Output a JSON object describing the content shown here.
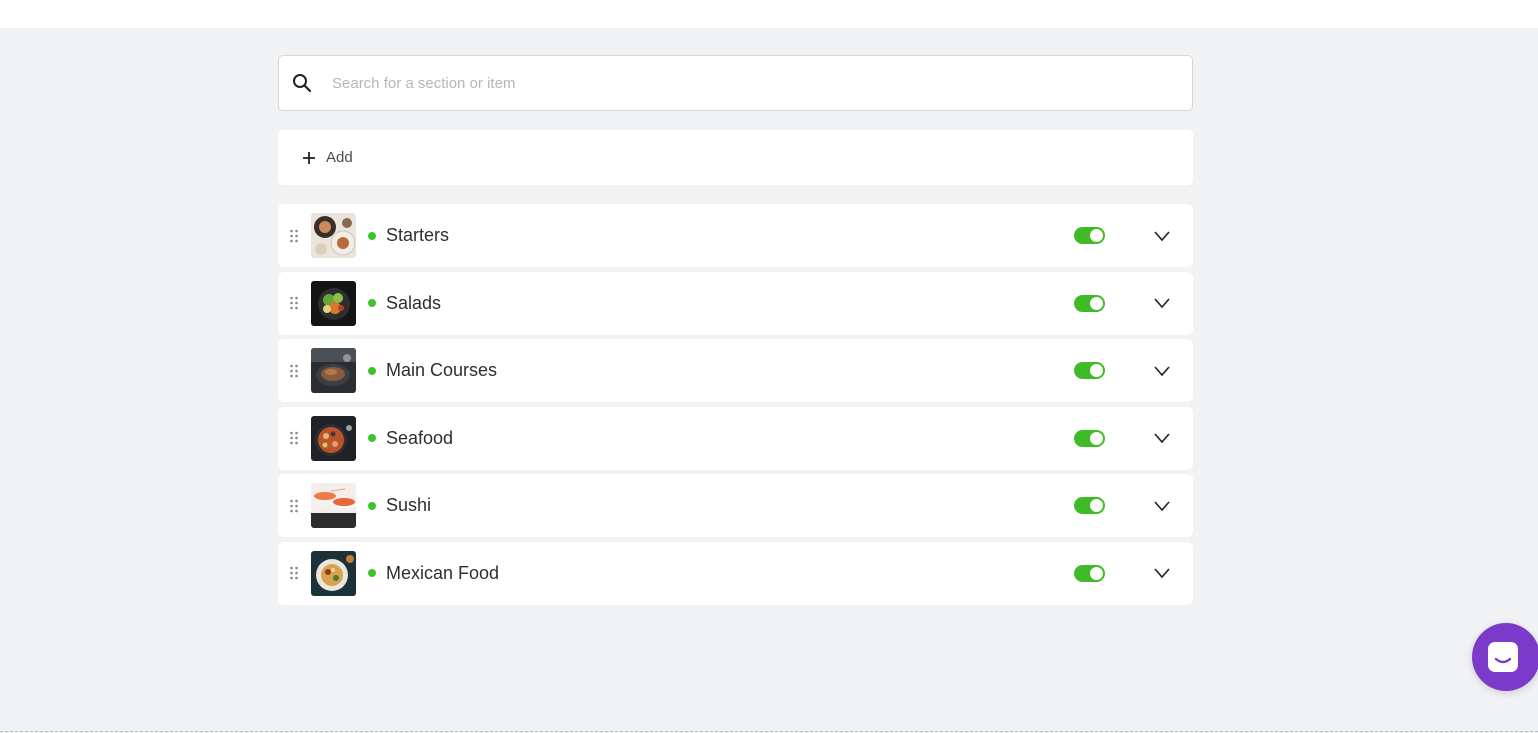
{
  "search": {
    "placeholder": "Search for a section or item",
    "icon": "search-icon"
  },
  "add": {
    "label": "Add",
    "icon": "plus-icon"
  },
  "colors": {
    "active_dot": "#3fc22c",
    "toggle_on": "#3fbb27",
    "chat_button": "#7b3ac9",
    "background": "#f1f2f4"
  },
  "sections": [
    {
      "name": "Starters",
      "status": "active",
      "enabled": true,
      "image": "starters-photo"
    },
    {
      "name": "Salads",
      "status": "active",
      "enabled": true,
      "image": "salads-photo"
    },
    {
      "name": "Main Courses",
      "status": "active",
      "enabled": true,
      "image": "main-courses-photo"
    },
    {
      "name": "Seafood",
      "status": "active",
      "enabled": true,
      "image": "seafood-photo"
    },
    {
      "name": "Sushi",
      "status": "active",
      "enabled": true,
      "image": "sushi-photo"
    },
    {
      "name": "Mexican Food",
      "status": "active",
      "enabled": true,
      "image": "mexican-food-photo"
    }
  ],
  "chat": {
    "icon": "chat-icon"
  }
}
